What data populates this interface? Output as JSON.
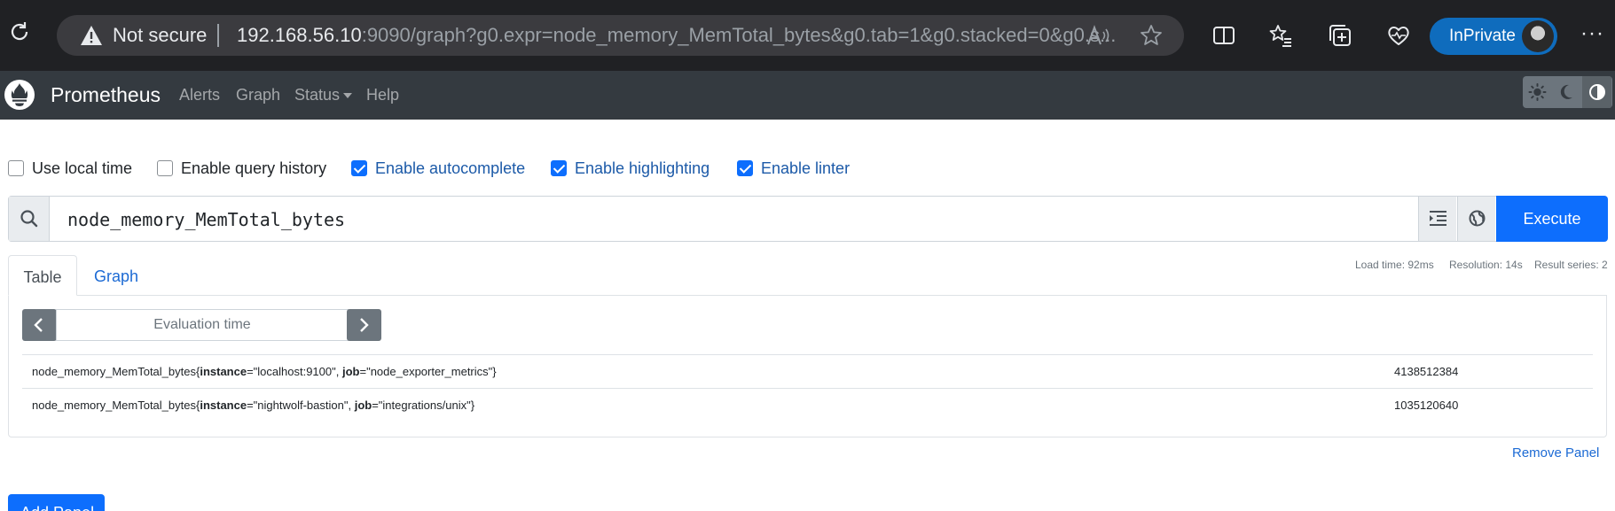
{
  "browser": {
    "security_label": "Not secure",
    "url_host": "192.168.56.10",
    "url_path": ":9090/graph?g0.expr=node_memory_MemTotal_bytes&g0.tab=1&g0.stacked=0&g0.s...",
    "inprivate_label": "InPrivate",
    "more_label": "···"
  },
  "navbar": {
    "brand": "Prometheus",
    "links": [
      "Alerts",
      "Graph",
      "Status",
      "Help"
    ]
  },
  "options": [
    {
      "label": "Use local time",
      "checked": false
    },
    {
      "label": "Enable query history",
      "checked": false
    },
    {
      "label": "Enable autocomplete",
      "checked": true
    },
    {
      "label": "Enable highlighting",
      "checked": true
    },
    {
      "label": "Enable linter",
      "checked": true
    }
  ],
  "query": {
    "expression": "node_memory_MemTotal_bytes",
    "execute_label": "Execute"
  },
  "tabs": {
    "table": "Table",
    "graph": "Graph"
  },
  "stats": {
    "load_time": "Load time: 92ms",
    "resolution": "Resolution: 14s",
    "result_series": "Result series: 2"
  },
  "eval_time": {
    "placeholder": "Evaluation time"
  },
  "results": [
    {
      "metric": "node_memory_MemTotal_bytes",
      "labels": [
        {
          "name": "instance",
          "value": "\"localhost:9100\""
        },
        {
          "name": "job",
          "value": "\"node_exporter_metrics\""
        }
      ],
      "value": "4138512384"
    },
    {
      "metric": "node_memory_MemTotal_bytes",
      "labels": [
        {
          "name": "instance",
          "value": "\"nightwolf-bastion\""
        },
        {
          "name": "job",
          "value": "\"integrations/unix\""
        }
      ],
      "value": "1035120640"
    }
  ],
  "remove_panel_label": "Remove Panel",
  "add_panel_label": "Add Panel"
}
